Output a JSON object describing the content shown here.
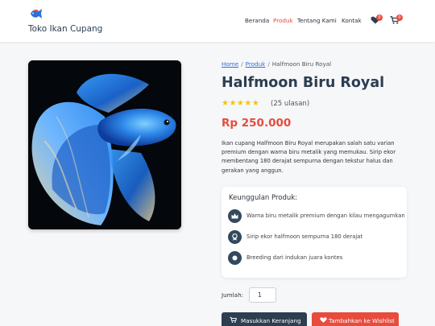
{
  "header": {
    "brand": "Toko Ikan Cupang",
    "nav": [
      "Beranda",
      "Produk",
      "Tentang Kami",
      "Kontak"
    ],
    "active_nav": "Produk",
    "wishlist_count": "0",
    "cart_count": "0"
  },
  "breadcrumb": [
    "Home",
    "Produk",
    "Halfmoon Biru Royal"
  ],
  "product": {
    "title": "Halfmoon Biru Royal",
    "stars": "★★★★★",
    "rating": 5,
    "reviews": "(25 ulasan)",
    "price": "Rp 250.000",
    "description": "Ikan cupang Halfmoon Biru Royal merupakan salah satu varian premium dengan warna biru metalik yang memukau. Sirip ekor membentang 180 derajat sempurna dengan tekstur halus dan gerakan yang anggun."
  },
  "features": {
    "heading": "Keunggulan Produk:",
    "items": [
      {
        "icon": "crown-icon",
        "text": "Warna biru metalik premium dengan kilau mengagumkan"
      },
      {
        "icon": "award-icon",
        "text": "Sirip ekor halfmoon sempurna 180 derajat"
      },
      {
        "icon": "dna-icon",
        "text": "Breeding dari indukan juara kontes"
      }
    ]
  },
  "quantity": {
    "label": "Jumlah:",
    "value": "1"
  },
  "buttons": {
    "cart": "Masukkan Keranjang",
    "wishlist": "Tambahkan ke Wishlist"
  },
  "colors": {
    "accent": "#e74c3c",
    "dark": "#2c3e50",
    "star": "#f1c40f"
  }
}
